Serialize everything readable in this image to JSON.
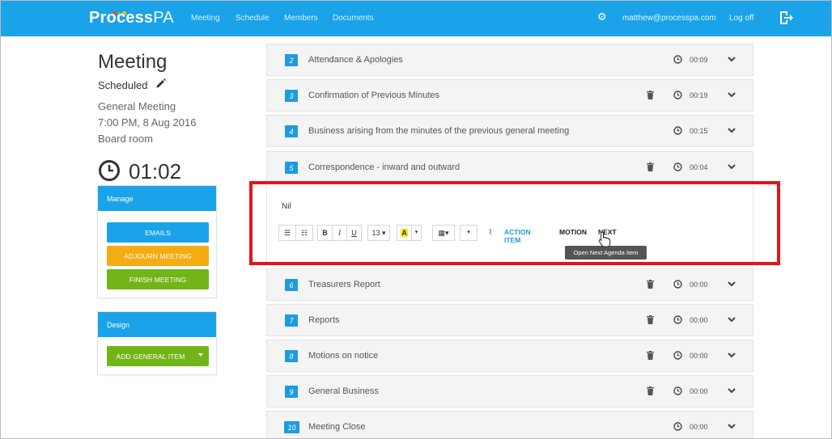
{
  "app": {
    "logo_bold": "Process",
    "logo_light": "PA",
    "logo_dot_colors": [
      "#e74c3c",
      "#2ecc71",
      "#f1c40f"
    ]
  },
  "nav": {
    "links": [
      "Meeting",
      "Schedule",
      "Members",
      "Documents"
    ],
    "user_email": "matthew@processpa.com",
    "logoff_label": "Log off",
    "accent": "#1aa3e8"
  },
  "meeting": {
    "title": "Meeting",
    "status": "Scheduled",
    "type": "General Meeting",
    "datetime": "7:00 PM, 8 Aug 2016",
    "location": "Board room",
    "elapsed": "01:02"
  },
  "manage_panel": {
    "title": "Manage",
    "emails_label": "EMAILS",
    "adjourn_label": "ADJOURN MEETING",
    "finish_label": "FINISH MEETING"
  },
  "design_panel": {
    "title": "Design",
    "add_item_label": "ADD GENERAL ITEM"
  },
  "agenda": {
    "items": [
      {
        "num": "2",
        "title": "Attendance & Apologies",
        "duration": "00:09",
        "deletable": false
      },
      {
        "num": "3",
        "title": "Confirmation of Previous Minutes",
        "duration": "00:19",
        "deletable": true
      },
      {
        "num": "4",
        "title": "Business arising from the minutes of the previous general meeting",
        "duration": "00:15",
        "deletable": false
      },
      {
        "num": "5",
        "title": "Correspondence - inward and outward",
        "duration": "00:04",
        "deletable": true
      },
      {
        "num": "6",
        "title": "Treasurers Report",
        "duration": "00:00",
        "deletable": true
      },
      {
        "num": "7",
        "title": "Reports",
        "duration": "00:00",
        "deletable": true
      },
      {
        "num": "8",
        "title": "Motions on notice",
        "duration": "00:00",
        "deletable": true
      },
      {
        "num": "9",
        "title": "General Business",
        "duration": "00:00",
        "deletable": true
      },
      {
        "num": "10",
        "title": "Meeting Close",
        "duration": "00:00",
        "deletable": false
      }
    ]
  },
  "editor": {
    "content": "Nil",
    "font_size": "13",
    "bold_label": "B",
    "italic_label": "I",
    "underline_label": "U",
    "highlight_label": "A",
    "action_item_label": "ACTION ITEM",
    "motion_label": "MOTION",
    "next_label": "NEXT",
    "tooltip": "Open Next Agenda Item"
  },
  "highlight_color": "#e2141c"
}
